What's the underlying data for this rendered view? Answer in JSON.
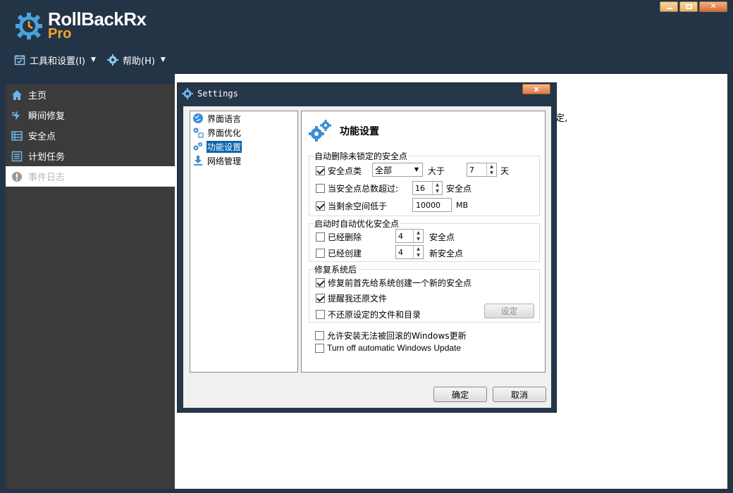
{
  "app": {
    "title": "RollBackRx",
    "subtitle": "Pro",
    "accent": "#f5a623"
  },
  "menu": {
    "tools": "工具和设置(I)",
    "help": "帮助(H)"
  },
  "sidebar": {
    "items": [
      {
        "label": "主页",
        "icon": "home-icon"
      },
      {
        "label": "瞬间修复",
        "icon": "bolt-icon"
      },
      {
        "label": "安全点",
        "icon": "list-icon"
      },
      {
        "label": "计划任务",
        "icon": "schedule-icon"
      },
      {
        "label": "事件日志",
        "icon": "alert-icon"
      }
    ]
  },
  "content": {
    "stray_text": "定,"
  },
  "dialog": {
    "title": "Settings",
    "close_label": "x",
    "tree": [
      {
        "label": "界面语言",
        "icon": "globe-icon"
      },
      {
        "label": "界面优化",
        "icon": "tools-icon"
      },
      {
        "label": "功能设置",
        "icon": "gears-icon"
      },
      {
        "label": "网络管理",
        "icon": "download-icon"
      }
    ],
    "panel_title": "功能设置",
    "group1": {
      "legend": "自动删除未锁定的安全点",
      "row1_label": "安全点类",
      "row1_select": "全部",
      "row1_greater": "大于",
      "row1_days": "7",
      "row1_unit": "天",
      "row2_label": "当安全点总数超过:",
      "row2_value": "16",
      "row2_unit": "安全点",
      "row3_label": "当剩余空间低于",
      "row3_value": "10000",
      "row3_unit": "MB"
    },
    "group2": {
      "legend": "启动时自动优化安全点",
      "row1_label": "已经删除",
      "row1_value": "4",
      "row1_unit": "安全点",
      "row2_label": "已经创建",
      "row2_value": "4",
      "row2_unit": "新安全点"
    },
    "group3": {
      "legend": "修复系统后",
      "row1_label": "修复前首先给系统创建一个新的安全点",
      "row2_label": "提醒我还原文件",
      "row3_label": "不还原设定的文件和目录",
      "setup_button": "设定"
    },
    "extra1": "允许安装无法被回滚的Windows更新",
    "extra2": "Turn off automatic Windows Update",
    "ok": "确定",
    "cancel": "取消"
  }
}
